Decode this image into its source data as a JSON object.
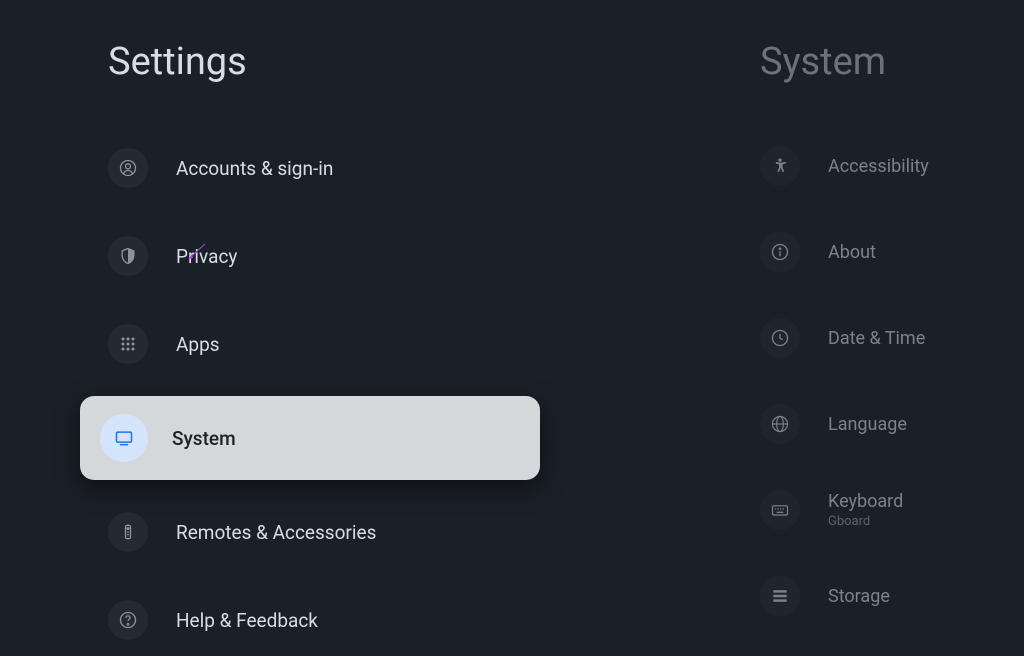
{
  "left": {
    "title": "Settings",
    "items": [
      {
        "label": "Accounts & sign-in",
        "icon": "account"
      },
      {
        "label": "Privacy",
        "icon": "shield"
      },
      {
        "label": "Apps",
        "icon": "apps"
      },
      {
        "label": "System",
        "icon": "tv",
        "selected": true
      },
      {
        "label": "Remotes & Accessories",
        "icon": "remote"
      },
      {
        "label": "Help & Feedback",
        "icon": "help"
      }
    ]
  },
  "right": {
    "title": "System",
    "items": [
      {
        "label": "Accessibility",
        "icon": "accessibility"
      },
      {
        "label": "About",
        "icon": "info"
      },
      {
        "label": "Date & Time",
        "icon": "clock"
      },
      {
        "label": "Language",
        "icon": "globe"
      },
      {
        "label": "Keyboard",
        "sublabel": "Gboard",
        "icon": "keyboard"
      },
      {
        "label": "Storage",
        "icon": "storage"
      }
    ]
  },
  "annotation": {
    "arrow_color": "#b040e8"
  }
}
